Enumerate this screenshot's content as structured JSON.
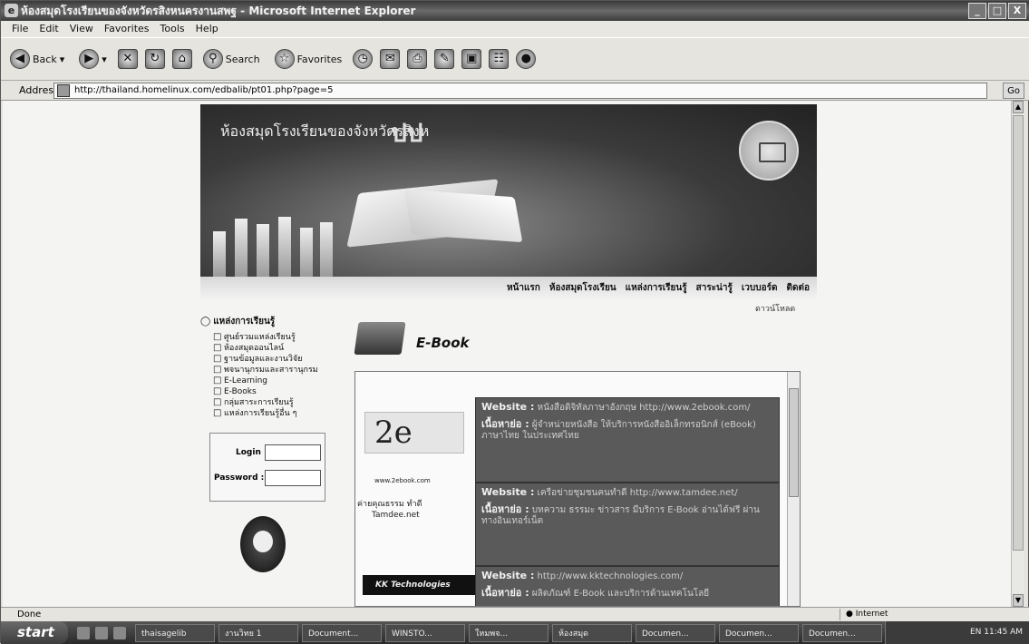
{
  "window": {
    "title": "ห้องสมุดโรงเรียนของจังหวัดรสิงหนครงานสพฐ - Microsoft Internet Explorer",
    "controls": [
      "_",
      "□",
      "X"
    ]
  },
  "menu": [
    "File",
    "Edit",
    "View",
    "Favorites",
    "Tools",
    "Help"
  ],
  "toolbar": {
    "back": "Back",
    "search": "Search",
    "favorites": "Favorites"
  },
  "address": {
    "label": "Address",
    "url": "http://thailand.homelinux.com/edbalib/pt01.php?page=5",
    "go": "Go"
  },
  "banner": {
    "title": "ห้องสมุดโรงเรียนของจังหวัดรสิงห",
    "highlight": "ปป"
  },
  "nav": {
    "items": [
      "หน้าแรก",
      "ห้องสมุดโรงเรียน",
      "แหล่งการเรียนรู้",
      "สาระน่ารู้",
      "เวบบอร์ด",
      "ติดต่อ"
    ],
    "sub": "ดาวน์โหลด"
  },
  "sidebar": {
    "heading": "แหล่งการเรียนรู้",
    "items": [
      "ศูนย์รวมแหล่งเรียนรู้",
      "ห้องสมุดออนไลน์",
      "ฐานข้อมูลและงานวิจัย",
      "พจนานุกรมและสารานุกรม",
      "E-Learning",
      "E-Books",
      "กลุ่มสาระการเรียนรู้",
      "แหล่งการเรียนรู้อื่น ๆ"
    ]
  },
  "login": {
    "login_label": "Login :",
    "password_label": "Password :"
  },
  "ebook": {
    "title": "E-Book",
    "logo_2e": "2e",
    "logo_2e_sub": "www.2ebook.com",
    "tamdee_line1": "ค่ายคุณธรรม ทำดี",
    "tamdee_line2": "Tamdee.net",
    "kk": "KK Technologies",
    "cards": [
      {
        "website_label": "Website :",
        "website": "หนังสือดิจิทัลภาษาอังกฤษ http://www.2ebook.com/",
        "content_label": "เนื้อหาย่อ :",
        "content": "ผู้จำหน่ายหนังสือ ให้บริการหนังสืออิเล็กทรอนิกส์ (eBook) ภาษาไทย ในประเทศไทย"
      },
      {
        "website_label": "Website :",
        "website": "เครือข่ายชุมชนคนทำดี http://www.tamdee.net/",
        "content_label": "เนื้อหาย่อ :",
        "content": "บทความ ธรรมะ ข่าวสาร มีบริการ E-Book อ่านได้ฟรี ผ่านทางอินเทอร์เน็ต"
      },
      {
        "website_label": "Website :",
        "website": "http://www.kktechnologies.com/",
        "content_label": "เนื้อหาย่อ :",
        "content": "ผลิตภัณฑ์ E-Book และบริการด้านเทคโนโลยี"
      }
    ]
  },
  "status": {
    "left": "Done",
    "zone": "Internet"
  },
  "taskbar": {
    "start": "start",
    "tasks": [
      "thaisagelib",
      "งานวิทย 1",
      "Document...",
      "WINSTO...",
      "ใหมพจ...",
      "ห้องสมุด",
      "Documen...",
      "Documen...",
      "Documen..."
    ],
    "tray": "EN  11:45 AM"
  },
  "colors": {
    "banner_bg": "#3b3b3b",
    "card_bg": "#5a5a5a",
    "page_bg": "#f4f4f2"
  }
}
